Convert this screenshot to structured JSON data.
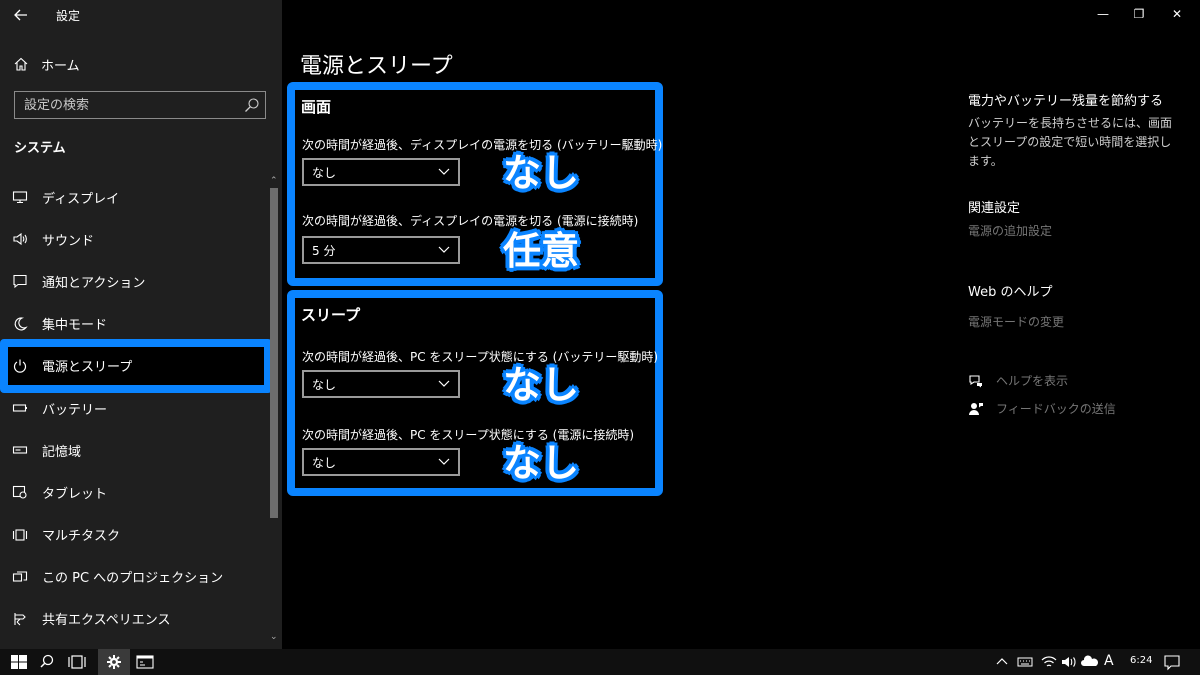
{
  "window": {
    "app_title": "設定",
    "controls": {
      "minimize": "—",
      "restore": "❐",
      "close": "✕"
    }
  },
  "sidebar": {
    "home_label": "ホーム",
    "search_placeholder": "設定の検索",
    "section_title": "システム",
    "items": [
      {
        "label": "ディスプレイ",
        "icon": "monitor-icon"
      },
      {
        "label": "サウンド",
        "icon": "speaker-icon"
      },
      {
        "label": "通知とアクション",
        "icon": "notification-icon"
      },
      {
        "label": "集中モード",
        "icon": "moon-icon"
      },
      {
        "label": "電源とスリープ",
        "icon": "power-icon",
        "selected": true
      },
      {
        "label": "バッテリー",
        "icon": "battery-icon"
      },
      {
        "label": "記憶域",
        "icon": "storage-icon"
      },
      {
        "label": "タブレット",
        "icon": "tablet-icon"
      },
      {
        "label": "マルチタスク",
        "icon": "multitask-icon"
      },
      {
        "label": "この PC へのプロジェクション",
        "icon": "projection-icon"
      },
      {
        "label": "共有エクスペリエンス",
        "icon": "shared-icon"
      }
    ]
  },
  "main": {
    "title": "電源とスリープ",
    "screen": {
      "title": "画面",
      "battery_label": "次の時間が経過後、ディスプレイの電源を切る (バッテリー駆動時)",
      "battery_value": "なし",
      "plugged_label": "次の時間が経過後、ディスプレイの電源を切る (電源に接続時)",
      "plugged_value": "5 分"
    },
    "sleep": {
      "title": "スリープ",
      "battery_label": "次の時間が経過後、PC をスリープ状態にする (バッテリー駆動時)",
      "battery_value": "なし",
      "plugged_label": "次の時間が経過後、PC をスリープ状態にする (電源に接続時)",
      "plugged_value": "なし"
    },
    "overlays": {
      "screen_battery": "なし",
      "screen_plugged": "任意",
      "sleep_battery": "なし",
      "sleep_plugged": "なし"
    }
  },
  "right": {
    "save_title": "電力やバッテリー残量を節約する",
    "save_text": "バッテリーを長持ちさせるには、画面とスリープの設定で短い時間を選択します。",
    "related_title": "関連設定",
    "related_link": "電源の追加設定",
    "web_help_title": "Web のヘルプ",
    "web_help_link": "電源モードの変更",
    "get_help": "ヘルプを表示",
    "feedback": "フィードバックの送信"
  },
  "taskbar": {
    "clock": "6:24",
    "ime": "A"
  },
  "colors": {
    "accent": "#0a84ff",
    "sidebar_bg": "#1f1f1f",
    "main_bg": "#000000"
  }
}
